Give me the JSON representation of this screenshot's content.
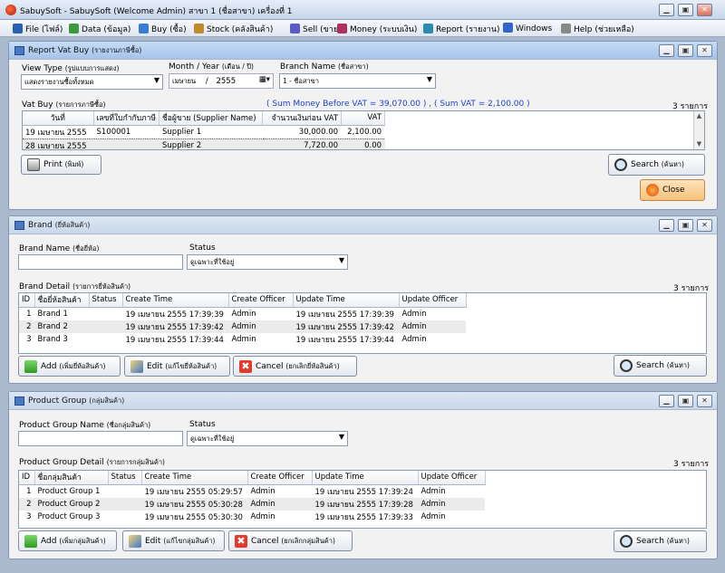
{
  "app": {
    "title": "SabuySoft - SabuySoft (Welcome Admin) สาขา 1 (ชื่อสาขา) เครื่องที่ 1"
  },
  "window_controls": {
    "minimize": "▁",
    "restore": "▣",
    "close": "✕"
  },
  "menu": [
    {
      "label": "File (ไฟล์)",
      "icon": "file-icon",
      "color": "#2b5fb3"
    },
    {
      "label": "Data (ข้อมูล)",
      "icon": "data-icon",
      "color": "#3c9a3c"
    },
    {
      "label": "Buy (ซื้อ)",
      "icon": "buy-icon",
      "color": "#3a7bd5"
    },
    {
      "label": "Stock (คลังสินค้า)",
      "icon": "stock-icon",
      "color": "#c08a2b"
    },
    {
      "label": "Sell (ขาย)",
      "icon": "sell-icon",
      "color": "#5a5ac8"
    },
    {
      "label": "Money (ระบบเงิน)",
      "icon": "money-icon",
      "color": "#b03060"
    },
    {
      "label": "Report (รายงาน)",
      "icon": "report-icon",
      "color": "#2e8bb0"
    },
    {
      "label": "Windows",
      "icon": "windows-icon",
      "color": "#3366cc"
    },
    {
      "label": "Help (ช่วยเหลือ)",
      "icon": "help-icon",
      "color": "#888888"
    }
  ],
  "report": {
    "title": "Report Vat Buy",
    "title_thai": "(รายงานภาษีซื้อ)",
    "view_type_label": "View Type",
    "view_type_label_thai": "(รูปแบบการแสดง)",
    "view_type_value": "แสดงรายงานซื้อทั้งหมด",
    "month_year_label": "Month / Year",
    "month_year_label_thai": "(เดือน / ปี)",
    "month_value": "เมษายน",
    "slash": "/",
    "year_value": "2555",
    "branch_label": "Branch Name",
    "branch_label_thai": "(ชื่อสาขา)",
    "branch_value": "1 - ชื่อสาขา",
    "list_label": "Vat Buy",
    "list_label_thai": "(รายการภาษีซื้อ)",
    "summary": "( Sum Money Before VAT = 39,070.00 ) , ( Sum VAT = 2,100.00 )",
    "count": "3 รายการ",
    "columns": [
      "วันที่",
      "เลขที่ใบกำกับภาษี",
      "ชื่อผู้ขาย  (Supplier Name)",
      "จำนวนเงินก่อน VAT",
      "VAT"
    ],
    "rows": [
      [
        "19 เมษายน  2555",
        "S100001",
        "Supplier 1",
        "30,000.00",
        "2,100.00"
      ],
      [
        "28 เมษายน  2555",
        "",
        "Supplier 2",
        "7,720.00",
        "0.00"
      ]
    ],
    "print_label": "Print",
    "print_label_thai": "(พิมพ์)",
    "search_label": "Search",
    "search_label_thai": "(ค้นหา)",
    "close_label": "Close"
  },
  "brand": {
    "title": "Brand",
    "title_thai": "(ยี่ห้อสินค้า)",
    "name_label": "Brand Name",
    "name_label_thai": "(ชื่อยี่ห้อ)",
    "name_value": "",
    "status_label": "Status",
    "status_value": "ดูเฉพาะที่ใช้อยู่",
    "detail_label": "Brand Detail",
    "detail_label_thai": "(รายการยี่ห้อสินค้า)",
    "count": "3 รายการ",
    "columns": [
      "ID",
      "ชื่อยี่ห้อสินค้า",
      "Status",
      "Create Time",
      "Create Officer",
      "Update Time",
      "Update Officer"
    ],
    "rows": [
      [
        "1",
        "Brand 1",
        "",
        "19 เมษายน  2555  17:39:39",
        "Admin",
        "19 เมษายน  2555  17:39:39",
        "Admin"
      ],
      [
        "2",
        "Brand 2",
        "",
        "19 เมษายน  2555  17:39:42",
        "Admin",
        "19 เมษายน  2555  17:39:42",
        "Admin"
      ],
      [
        "3",
        "Brand 3",
        "",
        "19 เมษายน  2555  17:39:44",
        "Admin",
        "19 เมษายน  2555  17:39:44",
        "Admin"
      ]
    ],
    "add_label": "Add",
    "add_label_thai": "(เพิ่มยี่ห้อสินค้า)",
    "edit_label": "Edit",
    "edit_label_thai": "(แก้ไขยี่ห้อสินค้า)",
    "cancel_label": "Cancel",
    "cancel_label_thai": "(ยกเลิกยี่ห้อสินค้า)",
    "search_label": "Search",
    "search_label_thai": "(ค้นหา)"
  },
  "group": {
    "title": "Product Group",
    "title_thai": "(กลุ่มสินค้า)",
    "name_label": "Product Group Name",
    "name_label_thai": "(ชื่อกลุ่มสินค้า)",
    "name_value": "",
    "status_label": "Status",
    "status_value": "ดูเฉพาะที่ใช้อยู่",
    "detail_label": "Product Group Detail",
    "detail_label_thai": "(รายการกลุ่มสินค้า)",
    "count": "3 รายการ",
    "columns": [
      "ID",
      "ชื่อกลุ่มสินค้า",
      "Status",
      "Create Time",
      "Create Officer",
      "Update Time",
      "Update Officer"
    ],
    "rows": [
      [
        "1",
        "Product Group 1",
        "",
        "19 เมษายน  2555  05:29:57",
        "Admin",
        "19 เมษายน  2555  17:39:24",
        "Admin"
      ],
      [
        "2",
        "Product Group 2",
        "",
        "19 เมษายน  2555  05:30:28",
        "Admin",
        "19 เมษายน  2555  17:39:28",
        "Admin"
      ],
      [
        "3",
        "Product Group 3",
        "",
        "19 เมษายน  2555  05:30:30",
        "Admin",
        "19 เมษายน  2555  17:39:33",
        "Admin"
      ]
    ],
    "add_label": "Add",
    "add_label_thai": "(เพิ่มกลุ่มสินค้า)",
    "edit_label": "Edit",
    "edit_label_thai": "(แก้ไขกลุ่มสินค้า)",
    "cancel_label": "Cancel",
    "cancel_label_thai": "(ยกเลิกกลุ่มสินค้า)",
    "search_label": "Search",
    "search_label_thai": "(ค้นหา)"
  },
  "colors": {
    "accent_blue": "#1f3fd0",
    "close_button": "#f6c27a"
  }
}
